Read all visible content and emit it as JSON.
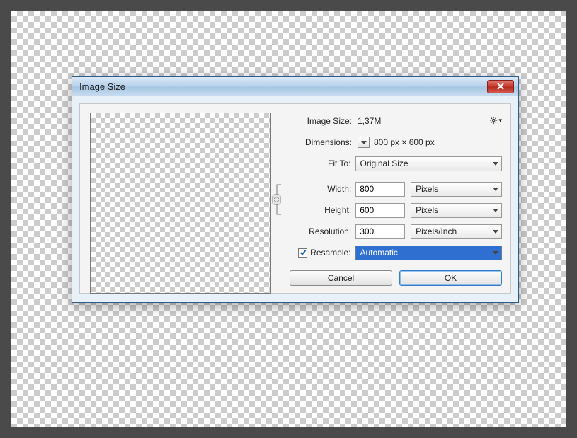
{
  "dialog": {
    "title": "Image Size",
    "imageSizeLabel": "Image Size:",
    "imageSizeValue": "1,37M",
    "dimensionsLabel": "Dimensions:",
    "dimensionsValue": "800 px  ×  600 px",
    "fitToLabel": "Fit To:",
    "fitToValue": "Original Size",
    "widthLabel": "Width:",
    "widthValue": "800",
    "widthUnit": "Pixels",
    "heightLabel": "Height:",
    "heightValue": "600",
    "heightUnit": "Pixels",
    "resolutionLabel": "Resolution:",
    "resolutionValue": "300",
    "resolutionUnit": "Pixels/Inch",
    "resampleLabel": "Resample:",
    "resampleChecked": true,
    "resampleValue": "Automatic",
    "cancelLabel": "Cancel",
    "okLabel": "OK"
  }
}
